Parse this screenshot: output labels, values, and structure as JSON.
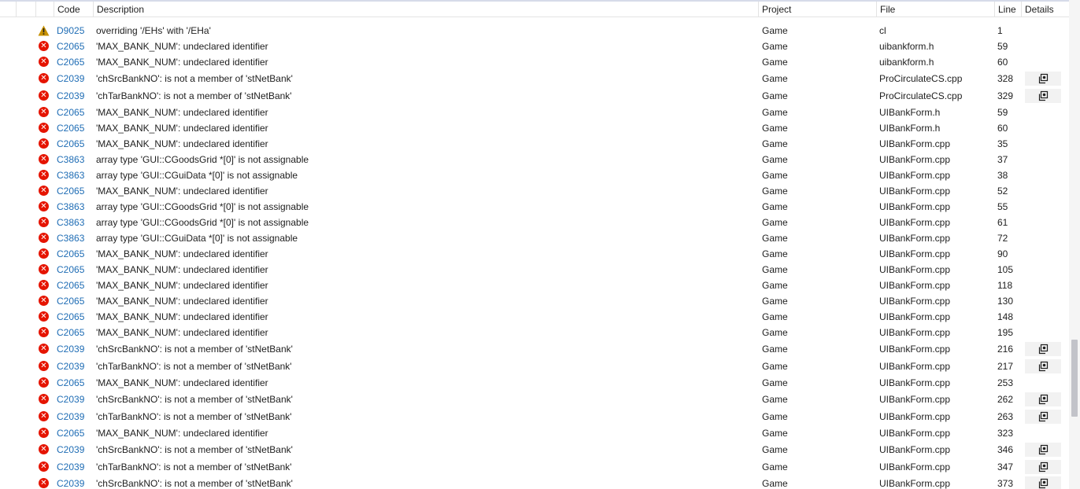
{
  "columns": {
    "code": "Code",
    "description": "Description",
    "project": "Project",
    "file": "File",
    "line": "Line",
    "details": "Details"
  },
  "rows": [
    {
      "severity": "warning",
      "code": "D9025",
      "description": "overriding '/EHs' with '/EHa'",
      "project": "Game",
      "file": "cl",
      "line": "1",
      "details": false
    },
    {
      "severity": "error",
      "code": "C2065",
      "description": "'MAX_BANK_NUM': undeclared identifier",
      "project": "Game",
      "file": "uibankform.h",
      "line": "59",
      "details": false
    },
    {
      "severity": "error",
      "code": "C2065",
      "description": "'MAX_BANK_NUM': undeclared identifier",
      "project": "Game",
      "file": "uibankform.h",
      "line": "60",
      "details": false
    },
    {
      "severity": "error",
      "code": "C2039",
      "description": "'chSrcBankNO': is not a member of 'stNetBank'",
      "project": "Game",
      "file": "ProCirculateCS.cpp",
      "line": "328",
      "details": true
    },
    {
      "severity": "error",
      "code": "C2039",
      "description": "'chTarBankNO': is not a member of 'stNetBank'",
      "project": "Game",
      "file": "ProCirculateCS.cpp",
      "line": "329",
      "details": true
    },
    {
      "severity": "error",
      "code": "C2065",
      "description": "'MAX_BANK_NUM': undeclared identifier",
      "project": "Game",
      "file": "UIBankForm.h",
      "line": "59",
      "details": false
    },
    {
      "severity": "error",
      "code": "C2065",
      "description": "'MAX_BANK_NUM': undeclared identifier",
      "project": "Game",
      "file": "UIBankForm.h",
      "line": "60",
      "details": false
    },
    {
      "severity": "error",
      "code": "C2065",
      "description": "'MAX_BANK_NUM': undeclared identifier",
      "project": "Game",
      "file": "UIBankForm.cpp",
      "line": "35",
      "details": false
    },
    {
      "severity": "error",
      "code": "C3863",
      "description": "array type 'GUI::CGoodsGrid *[0]' is not assignable",
      "project": "Game",
      "file": "UIBankForm.cpp",
      "line": "37",
      "details": false
    },
    {
      "severity": "error",
      "code": "C3863",
      "description": "array type 'GUI::CGuiData *[0]' is not assignable",
      "project": "Game",
      "file": "UIBankForm.cpp",
      "line": "38",
      "details": false
    },
    {
      "severity": "error",
      "code": "C2065",
      "description": "'MAX_BANK_NUM': undeclared identifier",
      "project": "Game",
      "file": "UIBankForm.cpp",
      "line": "52",
      "details": false
    },
    {
      "severity": "error",
      "code": "C3863",
      "description": "array type 'GUI::CGoodsGrid *[0]' is not assignable",
      "project": "Game",
      "file": "UIBankForm.cpp",
      "line": "55",
      "details": false
    },
    {
      "severity": "error",
      "code": "C3863",
      "description": "array type 'GUI::CGoodsGrid *[0]' is not assignable",
      "project": "Game",
      "file": "UIBankForm.cpp",
      "line": "61",
      "details": false
    },
    {
      "severity": "error",
      "code": "C3863",
      "description": "array type 'GUI::CGuiData *[0]' is not assignable",
      "project": "Game",
      "file": "UIBankForm.cpp",
      "line": "72",
      "details": false
    },
    {
      "severity": "error",
      "code": "C2065",
      "description": "'MAX_BANK_NUM': undeclared identifier",
      "project": "Game",
      "file": "UIBankForm.cpp",
      "line": "90",
      "details": false
    },
    {
      "severity": "error",
      "code": "C2065",
      "description": "'MAX_BANK_NUM': undeclared identifier",
      "project": "Game",
      "file": "UIBankForm.cpp",
      "line": "105",
      "details": false
    },
    {
      "severity": "error",
      "code": "C2065",
      "description": "'MAX_BANK_NUM': undeclared identifier",
      "project": "Game",
      "file": "UIBankForm.cpp",
      "line": "118",
      "details": false
    },
    {
      "severity": "error",
      "code": "C2065",
      "description": "'MAX_BANK_NUM': undeclared identifier",
      "project": "Game",
      "file": "UIBankForm.cpp",
      "line": "130",
      "details": false
    },
    {
      "severity": "error",
      "code": "C2065",
      "description": "'MAX_BANK_NUM': undeclared identifier",
      "project": "Game",
      "file": "UIBankForm.cpp",
      "line": "148",
      "details": false
    },
    {
      "severity": "error",
      "code": "C2065",
      "description": "'MAX_BANK_NUM': undeclared identifier",
      "project": "Game",
      "file": "UIBankForm.cpp",
      "line": "195",
      "details": false
    },
    {
      "severity": "error",
      "code": "C2039",
      "description": "'chSrcBankNO': is not a member of 'stNetBank'",
      "project": "Game",
      "file": "UIBankForm.cpp",
      "line": "216",
      "details": true
    },
    {
      "severity": "error",
      "code": "C2039",
      "description": "'chTarBankNO': is not a member of 'stNetBank'",
      "project": "Game",
      "file": "UIBankForm.cpp",
      "line": "217",
      "details": true
    },
    {
      "severity": "error",
      "code": "C2065",
      "description": "'MAX_BANK_NUM': undeclared identifier",
      "project": "Game",
      "file": "UIBankForm.cpp",
      "line": "253",
      "details": false
    },
    {
      "severity": "error",
      "code": "C2039",
      "description": "'chSrcBankNO': is not a member of 'stNetBank'",
      "project": "Game",
      "file": "UIBankForm.cpp",
      "line": "262",
      "details": true
    },
    {
      "severity": "error",
      "code": "C2039",
      "description": "'chTarBankNO': is not a member of 'stNetBank'",
      "project": "Game",
      "file": "UIBankForm.cpp",
      "line": "263",
      "details": true
    },
    {
      "severity": "error",
      "code": "C2065",
      "description": "'MAX_BANK_NUM': undeclared identifier",
      "project": "Game",
      "file": "UIBankForm.cpp",
      "line": "323",
      "details": false
    },
    {
      "severity": "error",
      "code": "C2039",
      "description": "'chSrcBankNO': is not a member of 'stNetBank'",
      "project": "Game",
      "file": "UIBankForm.cpp",
      "line": "346",
      "details": true
    },
    {
      "severity": "error",
      "code": "C2039",
      "description": "'chTarBankNO': is not a member of 'stNetBank'",
      "project": "Game",
      "file": "UIBankForm.cpp",
      "line": "347",
      "details": true
    },
    {
      "severity": "error",
      "code": "C2039",
      "description": "'chSrcBankNO': is not a member of 'stNetBank'",
      "project": "Game",
      "file": "UIBankForm.cpp",
      "line": "373",
      "details": true
    }
  ],
  "icons": {
    "error": "error-icon",
    "warning": "warning-icon",
    "details": "copy-details-icon"
  },
  "colors": {
    "error": "#e51400",
    "warning": "#c79100",
    "code_link": "#1f6db5",
    "header_border": "#d6dbe9",
    "scrollbar_thumb": "#c2c3c9"
  }
}
